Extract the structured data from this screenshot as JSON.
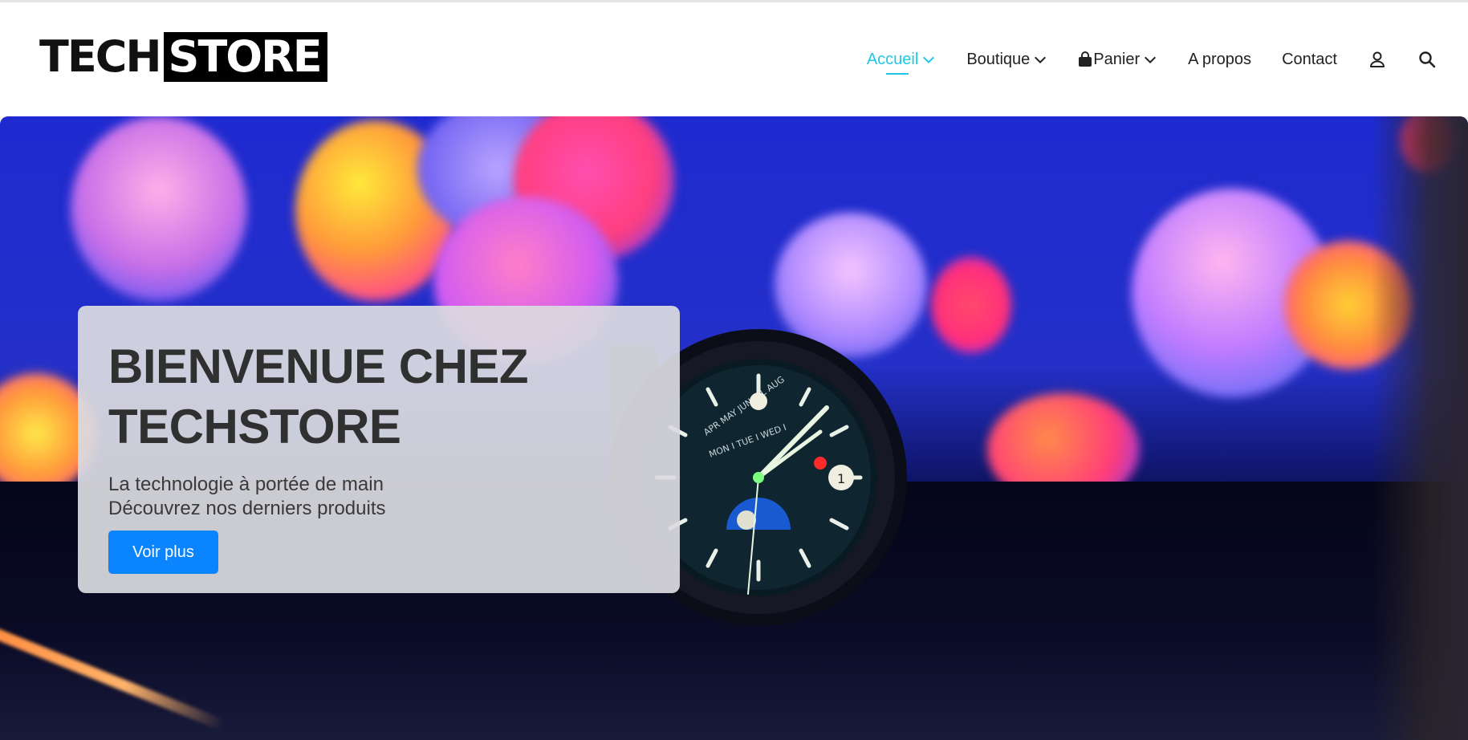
{
  "brand": {
    "logo_part1": "TECH",
    "logo_part2": "STORE"
  },
  "nav": {
    "items": [
      {
        "label": "Accueil",
        "active": true,
        "dropdown": true
      },
      {
        "label": "Boutique",
        "active": false,
        "dropdown": true
      },
      {
        "label": "Panier",
        "active": false,
        "dropdown": true
      },
      {
        "label": "A propos",
        "active": false,
        "dropdown": false
      },
      {
        "label": "Contact",
        "active": false,
        "dropdown": false
      }
    ],
    "icons": [
      "user-icon",
      "search-icon",
      "chevron-down-icon",
      "shopping-bag-icon"
    ]
  },
  "hero": {
    "title_line1": "BIENVENUE CHEZ",
    "title_line2": "TECHSTORE",
    "subtitle_line1": "La technologie à portée de main",
    "subtitle_line2": "Découvrez nos derniers produits",
    "button_label": "Voir plus"
  },
  "colors": {
    "accent": "#1fc7e8",
    "button": "#0a84ff",
    "text": "#222222"
  }
}
